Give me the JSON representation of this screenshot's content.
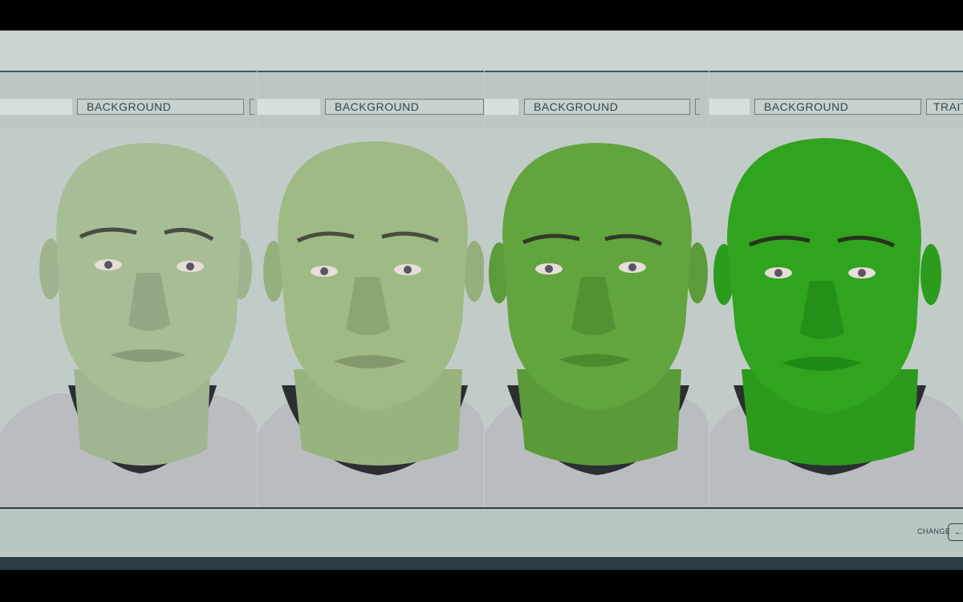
{
  "panels": [
    {
      "tab_label": "BACKGROUND",
      "skin_tone": "pale-green",
      "skin_color": "#a7bd96"
    },
    {
      "tab_label": "BACKGROUND",
      "skin_tone": "light-green",
      "skin_color": "#9fba84"
    },
    {
      "tab_label": "BACKGROUND",
      "skin_tone": "medium-green",
      "skin_color": "#62a43e"
    },
    {
      "tab_label": "BACKGROUND",
      "skin_tone": "bright-green",
      "skin_color": "#30a41e"
    }
  ],
  "next_tab_label": "TRAITS",
  "footer": {
    "change_label": "CHANGE",
    "change_key": "←"
  },
  "suit_color": "#b9bdc0"
}
